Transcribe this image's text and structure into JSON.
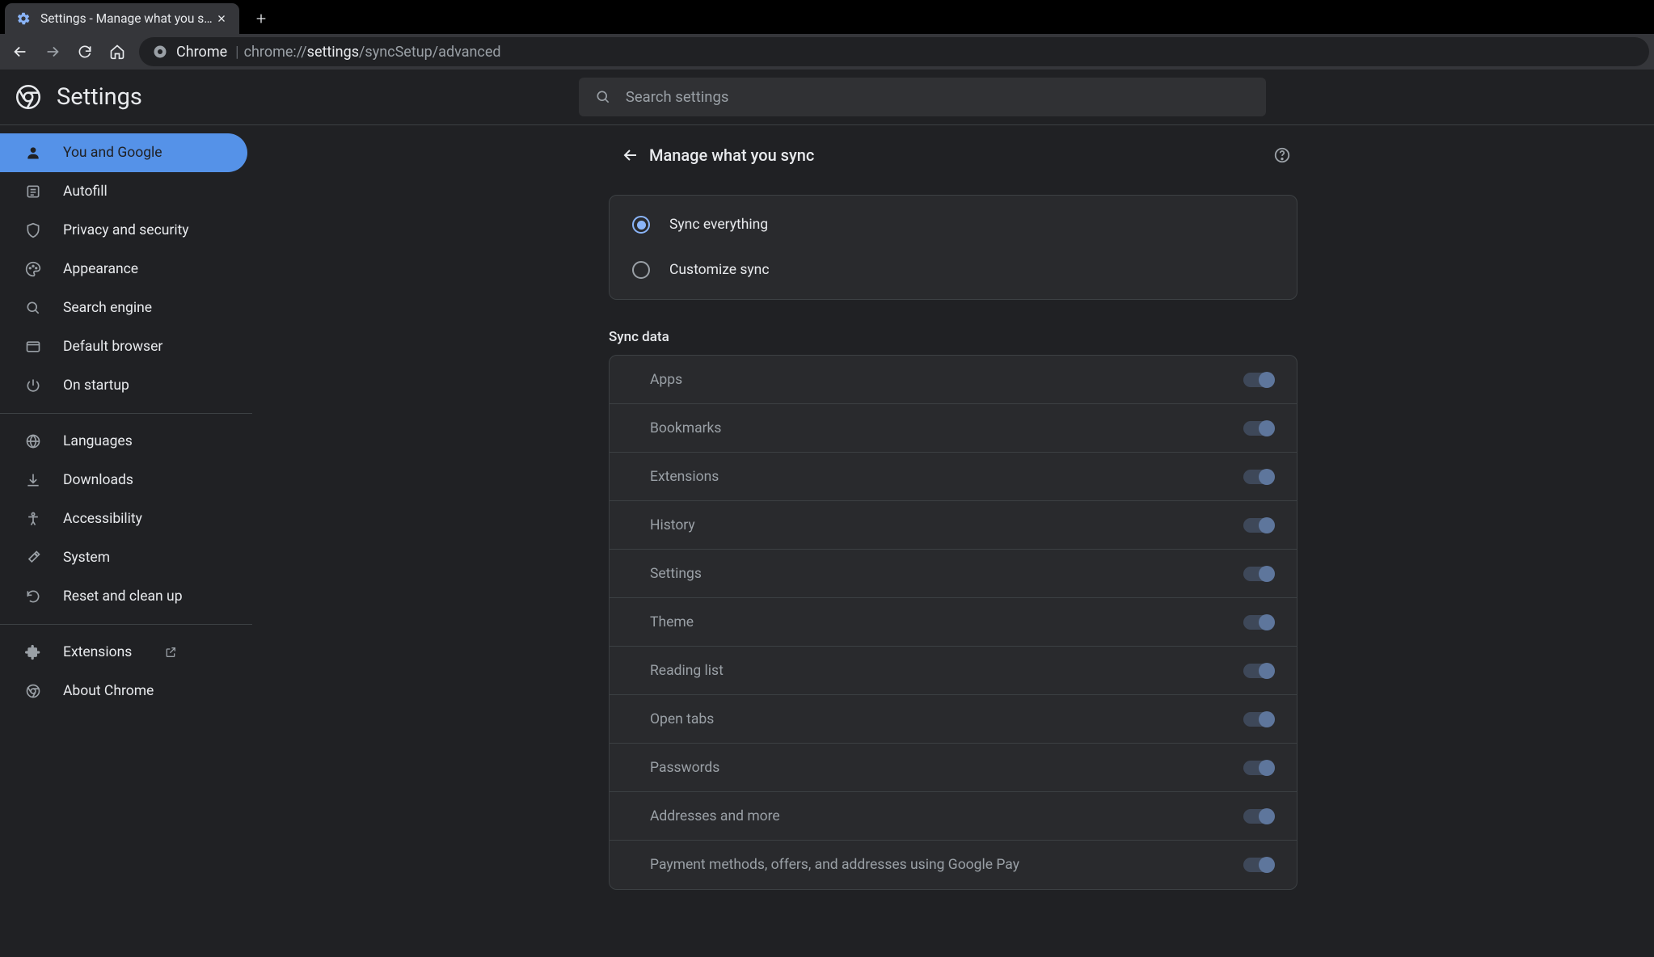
{
  "tab": {
    "title": "Settings - Manage what you sync"
  },
  "omnibox": {
    "site": "Chrome",
    "url_prefix": "chrome://",
    "url_path_strong": "settings",
    "url_path_rest": "/syncSetup/advanced"
  },
  "header": {
    "title": "Settings",
    "search_placeholder": "Search settings"
  },
  "sidebar": {
    "items": [
      {
        "label": "You and Google"
      },
      {
        "label": "Autofill"
      },
      {
        "label": "Privacy and security"
      },
      {
        "label": "Appearance"
      },
      {
        "label": "Search engine"
      },
      {
        "label": "Default browser"
      },
      {
        "label": "On startup"
      }
    ],
    "group2": [
      {
        "label": "Languages"
      },
      {
        "label": "Downloads"
      },
      {
        "label": "Accessibility"
      },
      {
        "label": "System"
      },
      {
        "label": "Reset and clean up"
      }
    ],
    "group3": [
      {
        "label": "Extensions"
      },
      {
        "label": "About Chrome"
      }
    ]
  },
  "panel": {
    "title": "Manage what you sync",
    "radio": [
      {
        "label": "Sync everything"
      },
      {
        "label": "Customize sync"
      }
    ],
    "section": "Sync data",
    "toggles": [
      {
        "label": "Apps"
      },
      {
        "label": "Bookmarks"
      },
      {
        "label": "Extensions"
      },
      {
        "label": "History"
      },
      {
        "label": "Settings"
      },
      {
        "label": "Theme"
      },
      {
        "label": "Reading list"
      },
      {
        "label": "Open tabs"
      },
      {
        "label": "Passwords"
      },
      {
        "label": "Addresses and more"
      },
      {
        "label": "Payment methods, offers, and addresses using Google Pay"
      }
    ]
  }
}
